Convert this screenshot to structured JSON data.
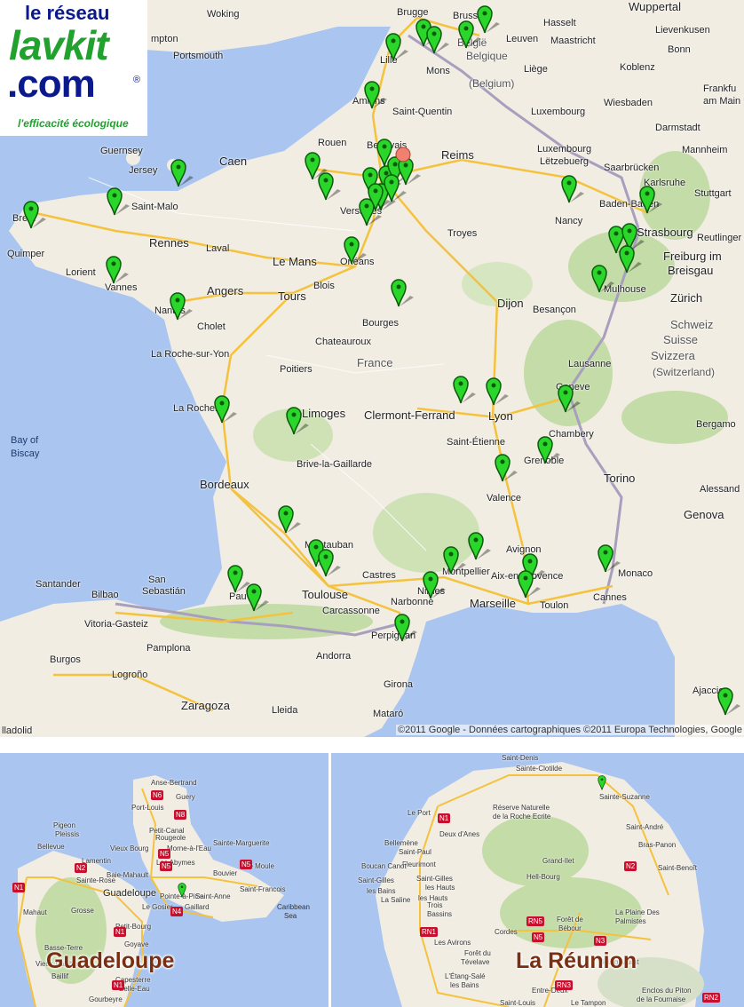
{
  "logo": {
    "line1": "le réseau",
    "line2": "lavkit",
    "line3": ".com",
    "registered": "®",
    "tagline": "l'efficacité écologique"
  },
  "main_map": {
    "copyright": "©2011 Google - Données cartographiques ©2011 Europa Technologies, Google",
    "labels": [
      {
        "text": "Woking",
        "cls": ""
      },
      {
        "text": "Brugge",
        "cls": ""
      },
      {
        "text": "Brussel",
        "cls": ""
      },
      {
        "text": "Hasselt",
        "cls": ""
      },
      {
        "text": "Wuppertal",
        "cls": ""
      },
      {
        "text": "Leuven",
        "cls": ""
      },
      {
        "text": "Lievenkusen",
        "cls": ""
      },
      {
        "text": "Portsmouth",
        "cls": ""
      },
      {
        "text": "mpton",
        "cls": ""
      },
      {
        "text": "Lille",
        "cls": ""
      },
      {
        "text": "Mons",
        "cls": ""
      },
      {
        "text": "België",
        "cls": "country"
      },
      {
        "text": "Belgique",
        "cls": "country"
      },
      {
        "text": "(Belgium)",
        "cls": "country"
      },
      {
        "text": "Maastricht",
        "cls": ""
      },
      {
        "text": "Liège",
        "cls": ""
      },
      {
        "text": "Bonn",
        "cls": ""
      },
      {
        "text": "Koblenz",
        "cls": ""
      },
      {
        "text": "Frankfu",
        "cls": ""
      },
      {
        "text": "am Main",
        "cls": ""
      },
      {
        "text": "Wiesbaden",
        "cls": ""
      },
      {
        "text": "Darmstadt",
        "cls": ""
      },
      {
        "text": "Mannheim",
        "cls": ""
      },
      {
        "text": "Amiens",
        "cls": ""
      },
      {
        "text": "Saint-Quentin",
        "cls": ""
      },
      {
        "text": "Luxembourg",
        "cls": ""
      },
      {
        "text": "Luxembourg",
        "cls": ""
      },
      {
        "text": "Lëtzebuerg",
        "cls": ""
      },
      {
        "text": "Saarbrücken",
        "cls": ""
      },
      {
        "text": "Karlsruhe",
        "cls": ""
      },
      {
        "text": "Stuttgart",
        "cls": ""
      },
      {
        "text": "Guernsey",
        "cls": ""
      },
      {
        "text": "Rouen",
        "cls": ""
      },
      {
        "text": "Beauvais",
        "cls": ""
      },
      {
        "text": "Reims",
        "cls": ""
      },
      {
        "text": "Jersey",
        "cls": ""
      },
      {
        "text": "Caen",
        "cls": ""
      },
      {
        "text": "Nancy",
        "cls": ""
      },
      {
        "text": "Baden-Baden",
        "cls": ""
      },
      {
        "text": "Saint-Malo",
        "cls": ""
      },
      {
        "text": "Brest",
        "cls": ""
      },
      {
        "text": "Versailles",
        "cls": ""
      },
      {
        "text": "Troyes",
        "cls": ""
      },
      {
        "text": "Strasbourg",
        "cls": ""
      },
      {
        "text": "Reutlinger",
        "cls": ""
      },
      {
        "text": "Rennes",
        "cls": ""
      },
      {
        "text": "Laval",
        "cls": ""
      },
      {
        "text": "Orléans",
        "cls": ""
      },
      {
        "text": "Freiburg im",
        "cls": ""
      },
      {
        "text": "Breisgau",
        "cls": ""
      },
      {
        "text": "Quimper",
        "cls": ""
      },
      {
        "text": "Lorient",
        "cls": ""
      },
      {
        "text": "Le Mans",
        "cls": ""
      },
      {
        "text": "Mulhouse",
        "cls": ""
      },
      {
        "text": "Vannes",
        "cls": ""
      },
      {
        "text": "Angers",
        "cls": ""
      },
      {
        "text": "Tours",
        "cls": ""
      },
      {
        "text": "Blois",
        "cls": ""
      },
      {
        "text": "Dijon",
        "cls": ""
      },
      {
        "text": "Besançon",
        "cls": ""
      },
      {
        "text": "Zürich",
        "cls": ""
      },
      {
        "text": "Nantes",
        "cls": ""
      },
      {
        "text": "Cholet",
        "cls": ""
      },
      {
        "text": "Bourges",
        "cls": ""
      },
      {
        "text": "Schweiz",
        "cls": "country"
      },
      {
        "text": "Suisse",
        "cls": "country"
      },
      {
        "text": "Svizzera",
        "cls": "country"
      },
      {
        "text": "(Switzerland)",
        "cls": "country"
      },
      {
        "text": "Chateauroux",
        "cls": ""
      },
      {
        "text": "La Roche-sur-Yon",
        "cls": ""
      },
      {
        "text": "Poitiers",
        "cls": ""
      },
      {
        "text": "France",
        "cls": "country big"
      },
      {
        "text": "Lausanne",
        "cls": ""
      },
      {
        "text": "Geneve",
        "cls": ""
      },
      {
        "text": "La Rochelle",
        "cls": ""
      },
      {
        "text": "Limoges",
        "cls": ""
      },
      {
        "text": "Clermont-Ferrand",
        "cls": ""
      },
      {
        "text": "Lyon",
        "cls": ""
      },
      {
        "text": "Chambery",
        "cls": ""
      },
      {
        "text": "Bergamo",
        "cls": ""
      },
      {
        "text": "Bay of",
        "cls": "sea"
      },
      {
        "text": "Biscay",
        "cls": "sea"
      },
      {
        "text": "Saint-Étienne",
        "cls": ""
      },
      {
        "text": "Grenoble",
        "cls": ""
      },
      {
        "text": "Brive-la-Gaillarde",
        "cls": ""
      },
      {
        "text": "Bordeaux",
        "cls": ""
      },
      {
        "text": "Valence",
        "cls": ""
      },
      {
        "text": "Torino",
        "cls": ""
      },
      {
        "text": "Alessand",
        "cls": ""
      },
      {
        "text": "Genova",
        "cls": ""
      },
      {
        "text": "Montauban",
        "cls": ""
      },
      {
        "text": "Avignon",
        "cls": ""
      },
      {
        "text": "Santander",
        "cls": ""
      },
      {
        "text": "San",
        "cls": ""
      },
      {
        "text": "Sebastián",
        "cls": ""
      },
      {
        "text": "Castres",
        "cls": ""
      },
      {
        "text": "Montpellier",
        "cls": ""
      },
      {
        "text": "Aix-en-Provence",
        "cls": ""
      },
      {
        "text": "Monaco",
        "cls": ""
      },
      {
        "text": "Cannes",
        "cls": ""
      },
      {
        "text": "Bilbao",
        "cls": ""
      },
      {
        "text": "Pau",
        "cls": ""
      },
      {
        "text": "Toulouse",
        "cls": ""
      },
      {
        "text": "Nimes",
        "cls": ""
      },
      {
        "text": "Narbonne",
        "cls": ""
      },
      {
        "text": "Marseille",
        "cls": ""
      },
      {
        "text": "Toulon",
        "cls": ""
      },
      {
        "text": "Carcassonne",
        "cls": ""
      },
      {
        "text": "Vitoria-Gasteiz",
        "cls": ""
      },
      {
        "text": "Pamplona",
        "cls": ""
      },
      {
        "text": "Perpignan",
        "cls": ""
      },
      {
        "text": "Burgos",
        "cls": ""
      },
      {
        "text": "Logroño",
        "cls": ""
      },
      {
        "text": "Andorra",
        "cls": ""
      },
      {
        "text": "Girona",
        "cls": ""
      },
      {
        "text": "Ajaccio",
        "cls": ""
      },
      {
        "text": "Zaragoza",
        "cls": ""
      },
      {
        "text": "Lleida",
        "cls": ""
      },
      {
        "text": "Mataró",
        "cls": ""
      },
      {
        "text": "lladolid",
        "cls": ""
      }
    ],
    "marker_count": 61
  },
  "guadeloupe": {
    "title": "Guadeloupe",
    "labels": [
      "Anse-Bertrand",
      "Guery",
      "Port-Louis",
      "Petit-Canal",
      "Pigeon",
      "Pleissis",
      "Bellevue",
      "Morne-à-l'Eau",
      "Sainte-Marguerite",
      "Vieux Bourg",
      "Rougeole",
      "Le Moule",
      "Baie-Mahault",
      "Les Abymes",
      "Bouvier",
      "Lamentin",
      "Guadeloupe",
      "Pointe-à-Pitre",
      "Le Gosier",
      "Saint-Anne",
      "Saint-Francois",
      "Caribbean",
      "Sea",
      "Mahaut",
      "Grosse",
      "Basse-Terre",
      "Capesterre",
      "Belle-Eau",
      "Baillif",
      "Gourbeyre",
      "Petit-Bourg",
      "Goyave",
      "Vieux-Habitants",
      "Gaillard",
      "Sainte-Rose"
    ],
    "roads": [
      "N6",
      "N8",
      "N5",
      "N5",
      "N4",
      "N2",
      "N1",
      "N1",
      "N1",
      "N5"
    ]
  },
  "reunion": {
    "title": "La Réunion",
    "labels": [
      "Saint-Denis",
      "Sainte-Clotilde",
      "Sainte-Suzanne",
      "Réserve Naturelle",
      "de la Roche Ecrite",
      "Le Port",
      "Saint-Paul",
      "Deux d'Anes",
      "Saint-André",
      "Bras-Panon",
      "Bellemène",
      "Fleurimont",
      "Grand-Ilet",
      "Saint-Benoît",
      "Boucan Canot",
      "Saint-Gilles",
      "les Hauts",
      "Hell-Bourg",
      "Saint-Gilles",
      "les Bains",
      "La Saline",
      "les Hauts",
      "Trois",
      "Bassins",
      "La Plaine Des",
      "Palmistes",
      "Forêt de",
      "Bébour",
      "Cordes",
      "Les Avirons",
      "Forêt du",
      "Tévelave",
      "L'Étang-Salé",
      "les Bains",
      "Entre-Deux",
      "Bourg-Murat",
      "Enclos du Piton",
      "de la Fournaise",
      "Saint-Louis",
      "Le Tampon"
    ],
    "roads": [
      "N1",
      "N2",
      "N3",
      "N5",
      "RN1",
      "RN2",
      "RN3",
      "RN5"
    ]
  }
}
